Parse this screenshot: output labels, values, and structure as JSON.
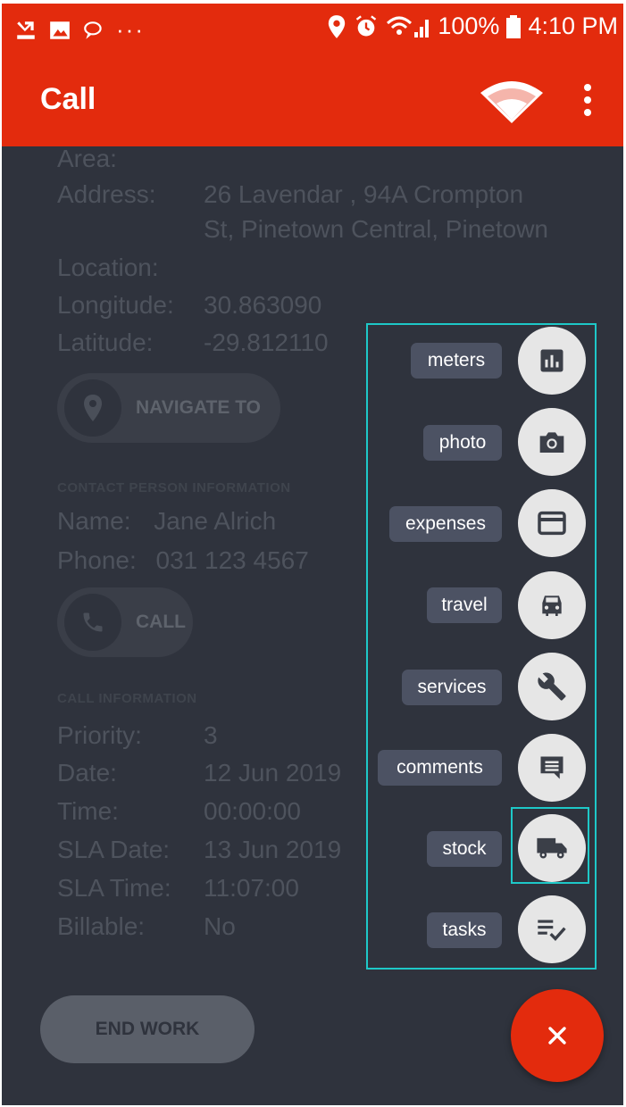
{
  "status_bar": {
    "overflow": "···",
    "battery": "100%",
    "time": "4:10 PM"
  },
  "app_bar": {
    "title": "Call"
  },
  "location": {
    "area_label": "Area:",
    "address_label": "Address:",
    "address_line1": "26 Lavendar , 94A Crompton",
    "address_line2": "St, Pinetown Central, Pinetown",
    "location_label": "Location:",
    "longitude_label": "Longitude:",
    "longitude": "30.863090",
    "latitude_label": "Latitude:",
    "latitude": "-29.812110",
    "navigate_label": "NAVIGATE TO"
  },
  "contact": {
    "header": "CONTACT PERSON INFORMATION",
    "name_label": "Name:",
    "name": "Jane Alrich",
    "phone_label": "Phone:",
    "phone": "031 123 4567",
    "call_label": "CALL"
  },
  "call_info": {
    "header": "CALL INFORMATION",
    "priority_label": "Priority:",
    "priority": "3",
    "date_label": "Date:",
    "date": "12 Jun 2019",
    "time_label": "Time:",
    "time": "00:00:00",
    "sla_date_label": "SLA Date:",
    "sla_date": "13 Jun 2019",
    "sla_time_label": "SLA Time:",
    "sla_time": "11:07:00",
    "billable_label": "Billable:",
    "billable": "No"
  },
  "end_work_label": "END WORK",
  "speed_dial": {
    "items": [
      {
        "label": "meters",
        "icon": "bar-chart-icon"
      },
      {
        "label": "photo",
        "icon": "camera-icon"
      },
      {
        "label": "expenses",
        "icon": "credit-card-icon"
      },
      {
        "label": "travel",
        "icon": "car-icon"
      },
      {
        "label": "services",
        "icon": "wrench-icon"
      },
      {
        "label": "comments",
        "icon": "comment-icon"
      },
      {
        "label": "stock",
        "icon": "truck-icon"
      },
      {
        "label": "tasks",
        "icon": "checklist-icon"
      }
    ],
    "close_icon": "close-icon"
  },
  "colors": {
    "accent": "#e32b0d",
    "background": "#2f333d",
    "chip": "#4c5263",
    "highlight": "#1ec8c8"
  }
}
